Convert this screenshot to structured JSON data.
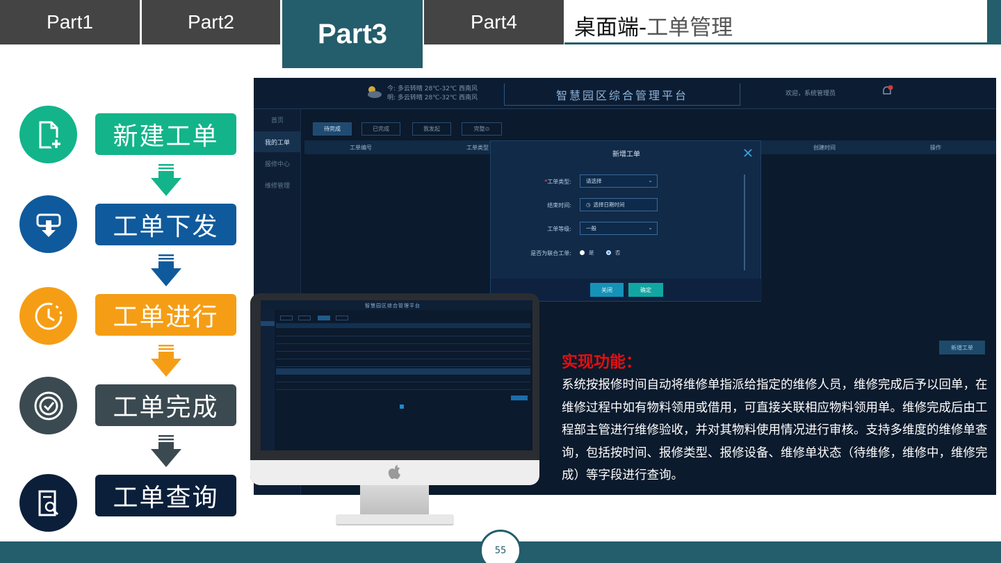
{
  "tabs": [
    {
      "label": "Part1"
    },
    {
      "label": "Part2"
    },
    {
      "label": "Part3",
      "active": true
    },
    {
      "label": "Part4"
    }
  ],
  "header": {
    "title_main": "桌面端-",
    "title_sub": "工单管理"
  },
  "flow": {
    "steps": [
      {
        "label": "新建工单",
        "color": "#13b48a",
        "icon": "file-add-icon"
      },
      {
        "label": "工单下发",
        "color": "#0f5a9c",
        "icon": "download-icon"
      },
      {
        "label": "工单进行",
        "color": "#f59e15",
        "icon": "clock-icon"
      },
      {
        "label": "工单完成",
        "color": "#3b4a50",
        "icon": "check-circle-icon"
      },
      {
        "label": "工单查询",
        "color": "#0b1f3a",
        "icon": "search-doc-icon"
      }
    ]
  },
  "app": {
    "weather_line1": "今: 多云转晴  28℃-32℃  西南风",
    "weather_line2": "明: 多云转晴  28℃-32℃  西南风",
    "title": "智慧园区综合管理平台",
    "welcome": "欢迎，系统管理员",
    "sidebar": [
      "首页",
      "我的工单",
      "报修中心",
      "维修管理"
    ],
    "tabs": [
      "待完成",
      "已完成",
      "我发起",
      "完整⊙"
    ],
    "columns": [
      "工单编号",
      "工单类型",
      "创建时间",
      "操作"
    ],
    "new_button": "新增工单",
    "modal": {
      "title": "新增工单",
      "type_label": "工单类型:",
      "type_value": "请选择",
      "time_label": "结束时间:",
      "time_value": "选择日期时间",
      "level_label": "工单等级:",
      "level_value": "一般",
      "joint_label": "是否为联合工单:",
      "yes": "是",
      "no": "否",
      "cancel": "关闭",
      "confirm": "确定"
    }
  },
  "description": {
    "title": "实现功能：",
    "body": "系统按报修时间自动将维修单指派给指定的维修人员，维修完成后予以回单，在维修过程中如有物料领用或借用，可直接关联相应物料领用单。维修完成后由工程部主管进行维修验收，并对其物料使用情况进行审核。支持多维度的维修单查询，包括按时间、报修类型、报修设备、维修单状态（待维修，维修中，维修完成）等字段进行查询。"
  },
  "monitor": {
    "title": "智慧园区综合管理平台"
  },
  "page_number": "55"
}
